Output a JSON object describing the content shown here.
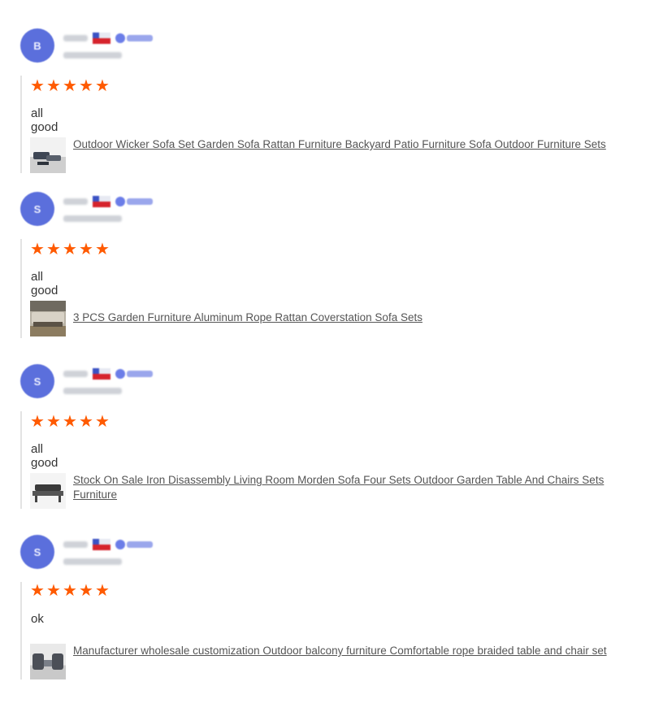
{
  "reviews": [
    {
      "avatar_letter": "B",
      "rating": 5,
      "text": "all good",
      "product_title": "Outdoor Wicker Sofa Set Garden Sofa Rattan Furniture Backyard Patio Furniture Sofa Outdoor Furniture Sets"
    },
    {
      "avatar_letter": "S",
      "rating": 5,
      "text": "all good",
      "product_title": "3 PCS Garden Furniture Aluminum Rope Rattan Coverstation Sofa Sets"
    },
    {
      "avatar_letter": "S",
      "rating": 5,
      "text": "all good",
      "product_title": "Stock On Sale Iron Disassembly Living Room Morden Sofa Four Sets Outdoor Garden Table And Chairs Sets Furniture"
    },
    {
      "avatar_letter": "S",
      "rating": 5,
      "text": "ok",
      "product_title": "Manufacturer wholesale customization Outdoor balcony furniture Comfortable rope braided table and chair set"
    }
  ],
  "icons": {
    "star": "star-icon",
    "flag": "flag-icon",
    "verified_badge": "verified-badge-icon"
  },
  "colors": {
    "star": "#ff5a00",
    "avatar": "#5b6fdc",
    "link": "#555555"
  }
}
